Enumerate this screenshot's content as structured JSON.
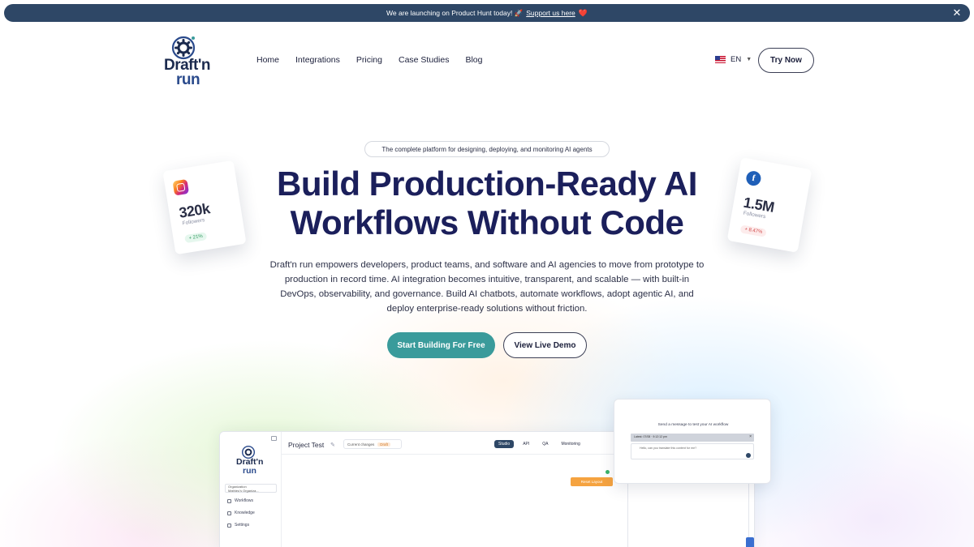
{
  "banner": {
    "text": "We are launching on Product Hunt today! 🚀",
    "link": "Support us here",
    "heart": "❤️"
  },
  "logo": {
    "line1": "Draft'n",
    "line2": "run"
  },
  "nav": {
    "items": [
      {
        "label": "Home"
      },
      {
        "label": "Integrations"
      },
      {
        "label": "Pricing"
      },
      {
        "label": "Case Studies"
      },
      {
        "label": "Blog"
      }
    ],
    "lang": "EN",
    "try_now": "Try Now"
  },
  "hero": {
    "pill": "The complete platform for designing, deploying, and monitoring AI agents",
    "headline_line1": "Build Production-Ready AI",
    "headline_line2": "Workflows Without Code",
    "description": "Draft'n run empowers developers, product teams, and software and AI agencies to move from prototype to production in record time. AI integration becomes intuitive, transparent, and scalable — with built-in DevOps, observability, and governance. Build AI chatbots, automate workflows, adopt agentic AI, and deploy enterprise-ready solutions without friction.",
    "cta_primary": "Start Building For Free",
    "cta_secondary": "View Live Demo"
  },
  "social_cards": {
    "instagram": {
      "count": "320k",
      "label": "Followers",
      "change": "+ 21%"
    },
    "facebook": {
      "count": "1.5M",
      "label": "Followers",
      "change": "+ 8.47%"
    }
  },
  "app_mockup": {
    "logo_line1": "Draft'n",
    "logo_line2": "run",
    "org_label": "Organization",
    "org_value": "Mathieu's Organiza...",
    "side_items": [
      {
        "label": "Workflows"
      },
      {
        "label": "Knowledge"
      },
      {
        "label": "Settings"
      }
    ],
    "project_title": "Project Test",
    "changes_label": "Current changes",
    "changes_badge": "Draft",
    "tabs": [
      {
        "label": "Studio"
      },
      {
        "label": "API"
      },
      {
        "label": "QA"
      },
      {
        "label": "Monitoring"
      }
    ],
    "reset_layout": "Reset Layout"
  },
  "chat_panel": {
    "title": "Send a message to test your AI workflow",
    "bar_text": "Latest: 07/08 · 9:12:12 pm",
    "input_placeholder": "Hello, can you translate this content for me?"
  },
  "colors": {
    "banner_bg": "#2e4766",
    "primary": "#3a9b9b",
    "headline": "#1b1f5b"
  }
}
